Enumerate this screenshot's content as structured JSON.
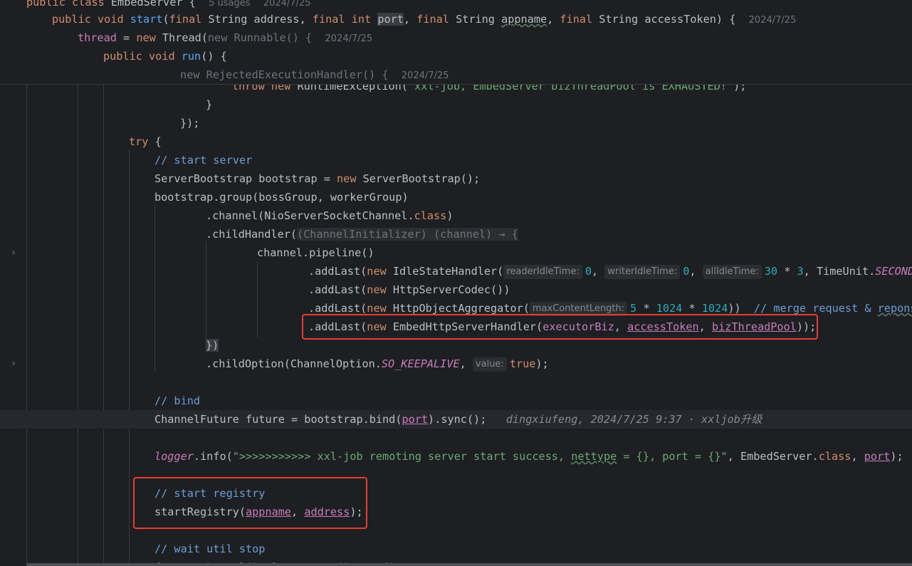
{
  "sticky_header": {
    "line1": {
      "kw1": "public",
      "kw2": "class",
      "name": "EmbedServer",
      "brace": " {",
      "usages": "5 usages",
      "date": "2024/7/25"
    },
    "line2": {
      "kw1": "public",
      "kw2": "void",
      "fn": "start",
      "open": "(",
      "final1": "final",
      "t1": "String",
      "p1": "address",
      "c1": ", ",
      "final2": "final",
      "t2": "int",
      "p2": "port",
      "c2": ", ",
      "final3": "final",
      "t3": "String",
      "p3": "appname",
      "c3": ", ",
      "final4": "final",
      "t4": "String",
      "p4": "accessToken",
      "close": ") {",
      "date": "2024/7/25"
    },
    "line3": {
      "fld": "thread",
      "eq": " = ",
      "kw": "new",
      "cls": " Thread(",
      "dimtxt": "new Runnable() {",
      "date": "2024/7/25"
    },
    "line4": {
      "kw1": "public",
      "kw2": "void",
      "fn": "run",
      "rest": "() {"
    },
    "line5": {
      "dimtxt": "new RejectedExecutionHandler() {",
      "date": "2024/7/25"
    }
  },
  "code": {
    "l_throw": {
      "kw1": "throw",
      "kw2": "new",
      "cls": " RuntimeException(",
      "str": "\"xxl-job, EmbedServer bizThreadPool is EXHAUSTED!\"",
      "end": ");"
    },
    "l_brace1": "}",
    "l_close1": "});",
    "l_try": {
      "kw": "try",
      "rest": " {"
    },
    "l_cm_start": "// start server",
    "l_sb": {
      "t": "ServerBootstrap bootstrap = ",
      "kw": "new",
      "rest": " ServerBootstrap();"
    },
    "l_group": "bootstrap.group(bossGroup, workerGroup)",
    "l_channel": {
      "a": ".channel(NioServerSocketChannel.",
      "kw": "class",
      "b": ")"
    },
    "l_child": {
      "a": ".childHandler(",
      "dim": "(ChannelInitializer) (channel) → {"
    },
    "l_pipeline": "channel.pipeline()",
    "l_idle": {
      "a": ".addLast(",
      "kw": "new",
      "b": " IdleStateHandler(",
      "h1": "readerIdleTime:",
      "v1": "0",
      "c1": ", ",
      "h2": "writerIdleTime:",
      "v2": "0",
      "c2": ", ",
      "h3": "allIdleTime:",
      "v3": "30",
      "op": " * ",
      "v4": "3",
      "c3": ", TimeUnit.",
      "st": "SECONDS"
    },
    "l_codec": {
      "a": ".addLast(",
      "kw": "new",
      "b": " HttpServerCodec())"
    },
    "l_agg": {
      "a": ".addLast(",
      "kw": "new",
      "b": " HttpObjectAggregator(",
      "h": "maxContentLength:",
      "n1": "5",
      "op1": " * ",
      "n2": "1024",
      "op2": " * ",
      "n3": "1024",
      "c": "))  ",
      "cm1": "// merge request & ",
      "cm2": "reponse"
    },
    "l_handler": {
      "a": ".addLast(",
      "kw": "new",
      "b": " EmbedHttpServerHandler(",
      "p1": "executorBiz",
      "c1": ", ",
      "p2": "accessToken",
      "c2": ", ",
      "p3": "bizThreadPool",
      "end": "));"
    },
    "l_closeparen": "})",
    "l_opt": {
      "a": ".childOption(ChannelOption.",
      "st": "SO_KEEPALIVE",
      "c": ", ",
      "h": "value:",
      "kw": "true",
      "end": ");"
    },
    "l_cm_bind": "// bind",
    "l_future": {
      "a": "ChannelFuture future = bootstrap.bind(",
      "p": "port",
      "b": ").sync();",
      "blame": "dingxiufeng, 2024/7/25 9:37 · xxljob升级"
    },
    "l_logger": {
      "log": "logger",
      "a": ".info(",
      "s1": "\">>>>>>>>>>> xxl-job remoting server start success, ",
      "s2": "nettype",
      "s3": " = {}, port = {}\"",
      "b": ", EmbedServer.",
      "kw": "class",
      "c": ", ",
      "p": "port",
      "end": ");"
    },
    "l_cm_reg": "// start registry",
    "l_reg": {
      "a": "startRegistry(",
      "p1": "appname",
      "c": ", ",
      "p2": "address",
      "end": ");"
    },
    "l_cm_wait": "// wait util stop",
    "l_close": "future.channel().closeFuture().sync();"
  },
  "gutter": {
    "fold_icon": "chevron-right-icon"
  },
  "colors": {
    "background": "#1e1f22",
    "keyword": "#cf8e6d",
    "comment": "#7a7e85",
    "string": "#6aab73",
    "number": "#2aacb8",
    "field": "#c77dbb",
    "function": "#56a8f5",
    "highlight_box": "#e53e35"
  }
}
